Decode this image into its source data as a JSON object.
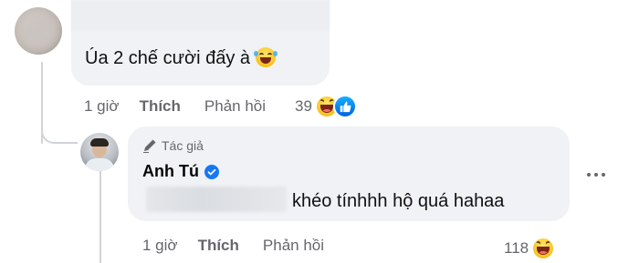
{
  "comment1": {
    "text": "Úa 2 chế cười đấy à",
    "emoji": "rolling-laughing-emoji",
    "time": "1 giờ",
    "like_label": "Thích",
    "reply_label": "Phản hồi",
    "reaction_count": "39",
    "reactions": [
      "haha",
      "like"
    ]
  },
  "reply": {
    "author_badge": "Tác giả",
    "author_name": "Anh Tú",
    "text": "khéo tínhhh hộ quá hahaa",
    "time": "1 giờ",
    "like_label": "Thích",
    "reply_label": "Phản hồi",
    "reaction_count": "118",
    "reactions": [
      "haha"
    ]
  },
  "colors": {
    "bubble": "#f0f2f5",
    "meta_text": "#65676b",
    "verified": "#1877f2",
    "like_blue": "#0866ff"
  }
}
